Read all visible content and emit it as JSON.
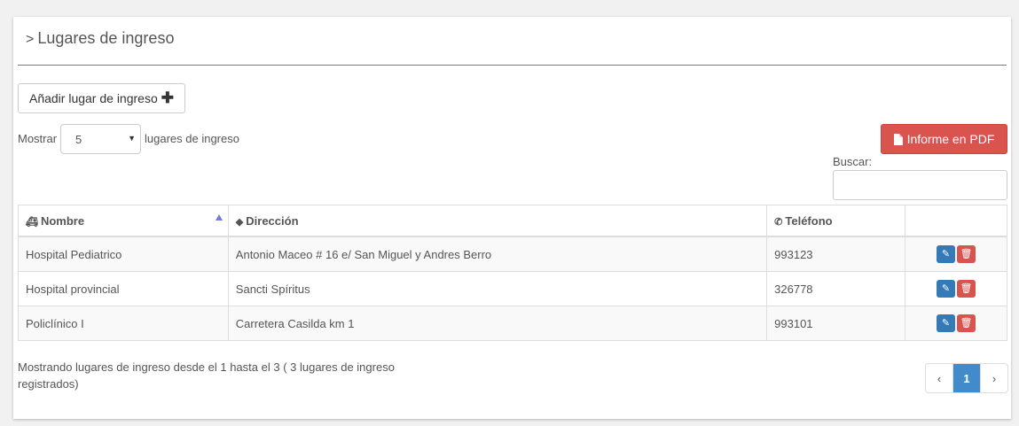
{
  "page": {
    "title": "Lugares de ingreso"
  },
  "toolbar": {
    "add_label": "Añadir lugar de ingreso",
    "pdf_label": "Informe en PDF"
  },
  "length": {
    "prefix": "Mostrar",
    "value": "5",
    "suffix": "lugares de ingreso"
  },
  "search": {
    "label": "Buscar:",
    "value": ""
  },
  "table": {
    "headers": [
      "Nombre",
      "Dirección",
      "Teléfono"
    ],
    "rows": [
      {
        "nombre": "Hospital Pediatrico",
        "direccion": "Antonio Maceo # 16 e/ San Miguel y Andres Berro",
        "telefono": "993123"
      },
      {
        "nombre": "Hospital provincial",
        "direccion": "Sancti Spíritus",
        "telefono": "326778"
      },
      {
        "nombre": "Policlínico I",
        "direccion": "Carretera Casilda km 1",
        "telefono": "993101"
      }
    ]
  },
  "footer": {
    "info": "Mostrando lugares de ingreso desde el 1 hasta el 3 ( 3 lugares de ingreso registrados)"
  },
  "pagination": {
    "prev": "‹",
    "current": "1",
    "next": "›"
  },
  "colors": {
    "accent": "#337ab7",
    "danger": "#d9534f",
    "page_active": "#428bca"
  }
}
